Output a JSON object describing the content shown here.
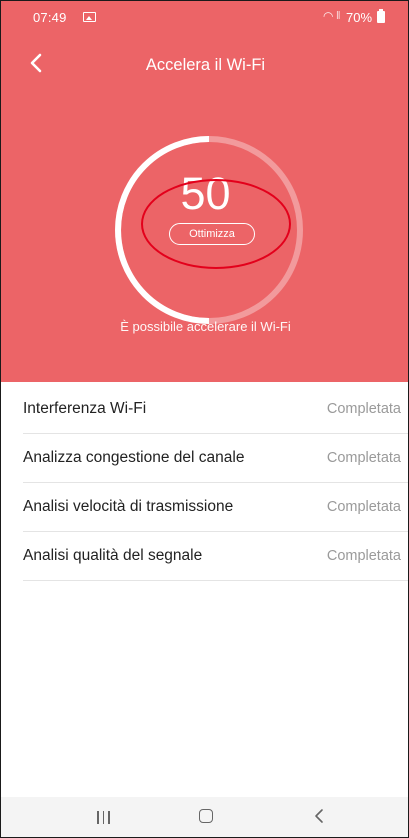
{
  "status_bar": {
    "time": "07:49",
    "battery": "70%",
    "icons": [
      "gallery-icon",
      "wifi-icon",
      "signal-icon",
      "battery-icon"
    ]
  },
  "header": {
    "title": "Accelera il Wi-Fi",
    "back_icon": "chevron-left-icon"
  },
  "gauge": {
    "score": "50",
    "score_fraction": 0.5,
    "button_label": "Ottimizza",
    "subtitle": "È possibile accelerare il Wi-Fi"
  },
  "checks": [
    {
      "label": "Interferenza Wi-Fi",
      "status": "Completata"
    },
    {
      "label": "Analizza congestione del canale",
      "status": "Completata"
    },
    {
      "label": "Analisi velocità di trasmissione",
      "status": "Completata"
    },
    {
      "label": "Analisi qualità del segnale",
      "status": "Completata"
    }
  ],
  "nav_bar": {
    "icons": [
      "recents-icon",
      "home-icon",
      "back-icon"
    ]
  },
  "colors": {
    "hero_background": "#ec6467",
    "annotation_circle": "#e3001b",
    "status_text": "#9a9a9a"
  }
}
